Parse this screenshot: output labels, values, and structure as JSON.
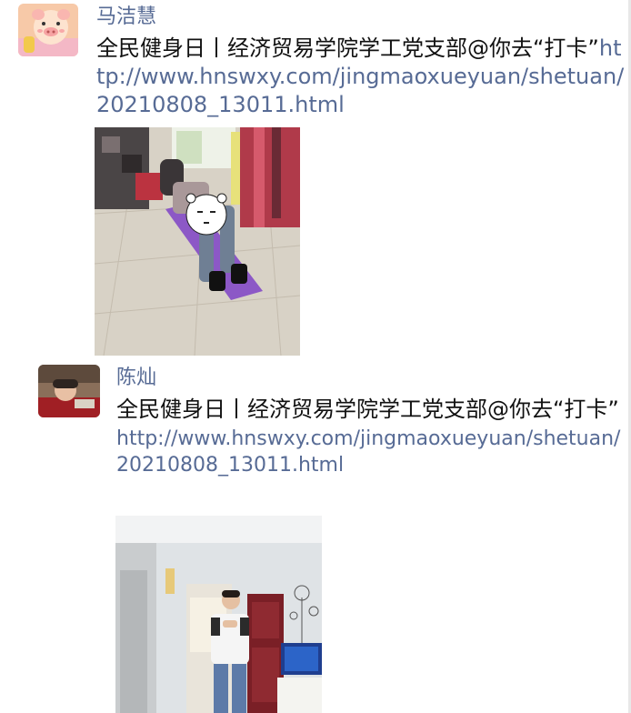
{
  "posts": [
    {
      "author": "马洁慧",
      "text": "全民健身日丨经济贸易学院学工党支部@你去“打卡”",
      "link": "http://www.hnswxy.com/jingmaoxueyuan/shetuan/20210808_13011.html"
    },
    {
      "author": "陈灿",
      "text": "全民健身日丨经济贸易学院学工党支部@你去“打卡”",
      "link": "http://www.hnswxy.com/jingmaoxueyuan/shetuan/20210808_13011.html"
    }
  ],
  "colors": {
    "author_name": "#576b95",
    "link": "#576b95",
    "text": "#111111"
  }
}
